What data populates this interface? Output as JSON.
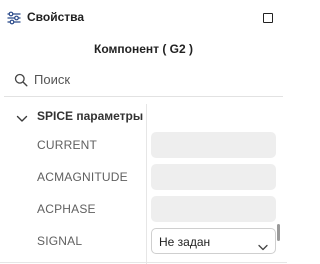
{
  "header": {
    "title": "Свойства",
    "settings_icon": "sliders-icon",
    "maximize_icon": "maximize-icon"
  },
  "component": {
    "title": "Компонент ( G2 )"
  },
  "search": {
    "placeholder": "Поиск",
    "value": ""
  },
  "section": {
    "label": "SPICE параметры",
    "expanded": true
  },
  "properties": [
    {
      "name": "CURRENT",
      "value": ""
    },
    {
      "name": "ACMAGNITUDE",
      "value": ""
    },
    {
      "name": "ACPHASE",
      "value": ""
    },
    {
      "name": "SIGNAL",
      "value": "Не задан"
    }
  ],
  "colors": {
    "accent": "#222222",
    "field_bg": "#eeeeee"
  }
}
